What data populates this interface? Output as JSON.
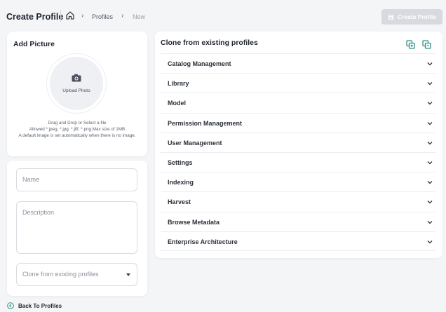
{
  "header": {
    "title": "Create Profile",
    "breadcrumb": [
      "Profiles",
      "New"
    ],
    "create_button_label": "Create Profile"
  },
  "picture_card": {
    "title": "Add Picture",
    "upload_label": "Upload Photo",
    "help_lines": [
      "Drag and Drop or Select a file",
      "Allowed *.jpeg, *.jpg, *.jfif, *.png.Max size of 1MB",
      "A default image is set automatically when there is no image."
    ]
  },
  "form": {
    "name_placeholder": "Name",
    "description_placeholder": "Description",
    "clone_select_placeholder": "Clone from existing profiles"
  },
  "back_link": "Back To Profiles",
  "clone_panel": {
    "title": "Clone from existing profiles",
    "items": [
      {
        "label": "Catalog Management"
      },
      {
        "label": "Library"
      },
      {
        "label": "Model"
      },
      {
        "label": "Permission Management"
      },
      {
        "label": "User Management"
      },
      {
        "label": "Settings"
      },
      {
        "label": "Indexing"
      },
      {
        "label": "Harvest"
      },
      {
        "label": "Browse Metadata"
      },
      {
        "label": "Enterprise Architecture"
      }
    ]
  },
  "colors": {
    "accent": "#2f8f86",
    "disabled_button": "#d7dade",
    "background": "#f4f5f7"
  }
}
